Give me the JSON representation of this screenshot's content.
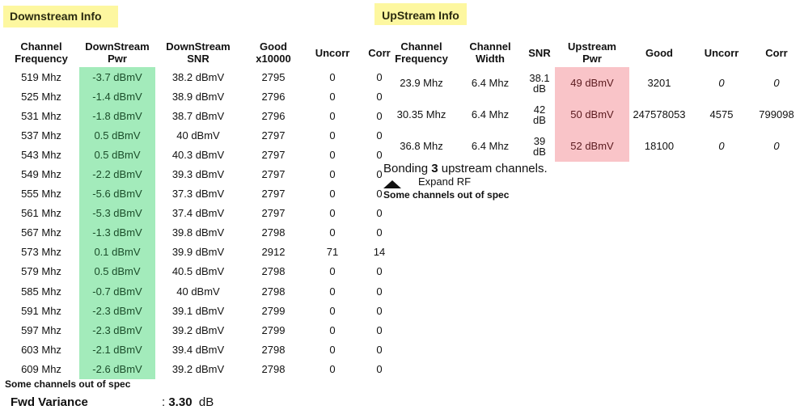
{
  "downstream": {
    "title": "Downstream Info",
    "headers": [
      "Channel\nFrequency",
      "DownStream\nPwr",
      "DownStream\nSNR",
      "Good\nx10000",
      "Uncorr",
      "Corr"
    ],
    "rows": [
      [
        "519 Mhz",
        "-3.7 dBmV",
        "38.2 dBmV",
        "2795",
        "0",
        "0"
      ],
      [
        "525 Mhz",
        "-1.4 dBmV",
        "38.9 dBmV",
        "2796",
        "0",
        "0"
      ],
      [
        "531 Mhz",
        "-1.8 dBmV",
        "38.7 dBmV",
        "2796",
        "0",
        "0"
      ],
      [
        "537 Mhz",
        "0.5 dBmV",
        "40 dBmV",
        "2797",
        "0",
        "0"
      ],
      [
        "543 Mhz",
        "0.5 dBmV",
        "40.3 dBmV",
        "2797",
        "0",
        "0"
      ],
      [
        "549 Mhz",
        "-2.2 dBmV",
        "39.3 dBmV",
        "2797",
        "0",
        "0"
      ],
      [
        "555 Mhz",
        "-5.6 dBmV",
        "37.3 dBmV",
        "2797",
        "0",
        "0"
      ],
      [
        "561 Mhz",
        "-5.3 dBmV",
        "37.4 dBmV",
        "2797",
        "0",
        "0"
      ],
      [
        "567 Mhz",
        "-1.3 dBmV",
        "39.8 dBmV",
        "2798",
        "0",
        "0"
      ],
      [
        "573 Mhz",
        "0.1 dBmV",
        "39.9 dBmV",
        "2912",
        "71",
        "14"
      ],
      [
        "579 Mhz",
        "0.5 dBmV",
        "40.5 dBmV",
        "2798",
        "0",
        "0"
      ],
      [
        "585 Mhz",
        "-0.7 dBmV",
        "40 dBmV",
        "2798",
        "0",
        "0"
      ],
      [
        "591 Mhz",
        "-2.3 dBmV",
        "39.1 dBmV",
        "2799",
        "0",
        "0"
      ],
      [
        "597 Mhz",
        "-2.3 dBmV",
        "39.2 dBmV",
        "2799",
        "0",
        "0"
      ],
      [
        "603 Mhz",
        "-2.1 dBmV",
        "39.4 dBmV",
        "2798",
        "0",
        "0"
      ],
      [
        "609 Mhz",
        "-2.6 dBmV",
        "39.2 dBmV",
        "2798",
        "0",
        "0"
      ]
    ],
    "status": "Some channels out of spec",
    "fwd_variance": {
      "label": "Fwd Variance",
      "prefix": ": ",
      "value": "3.30",
      "unit": "dB"
    },
    "pwr_highlight_color": "#a3ebbb"
  },
  "upstream": {
    "title": "UpStream Info",
    "headers": [
      "Channel\nFrequency",
      "Channel\nWidth",
      "SNR",
      "Upstream\nPwr",
      "Good",
      "Uncorr",
      "Corr"
    ],
    "rows": [
      [
        "23.9 Mhz",
        "6.4 Mhz",
        "38.1\ndB",
        "49 dBmV",
        "3201",
        "0",
        "0"
      ],
      [
        "30.35 Mhz",
        "6.4 Mhz",
        "42\ndB",
        "50 dBmV",
        "247578053",
        "4575",
        "799098"
      ],
      [
        "36.8 Mhz",
        "6.4 Mhz",
        "39\ndB",
        "52 dBmV",
        "18100",
        "0",
        "0"
      ]
    ],
    "italic_zero_rows": [
      0,
      2
    ],
    "bonding": {
      "prefix": "Bonding ",
      "count": "3",
      "suffix": " upstream channels."
    },
    "expand_label": "Expand RF",
    "expand_icon": "triangle-up-icon",
    "status": "Some channels out of spec",
    "pwr_highlight_color": "#f9c4c8"
  }
}
